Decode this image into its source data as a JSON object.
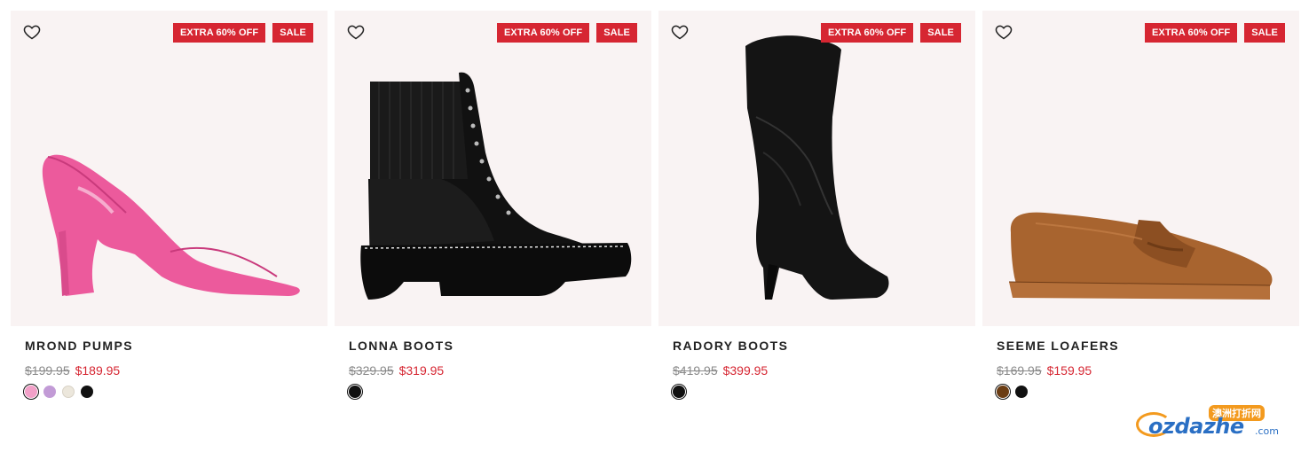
{
  "products": [
    {
      "name": "MROND PUMPS",
      "badge_extra": "EXTRA 60% OFF",
      "badge_sale": "SALE",
      "was_price": "$199.95",
      "now_price": "$189.95",
      "image": "pink-pump",
      "swatches": [
        "#f2a0c8",
        "#c29bd6",
        "#ece7dc",
        "#111111"
      ],
      "selected_swatch": 0
    },
    {
      "name": "LONNA BOOTS",
      "badge_extra": "EXTRA 60% OFF",
      "badge_sale": "SALE",
      "was_price": "$329.95",
      "now_price": "$319.95",
      "image": "black-combat-boot",
      "swatches": [
        "#111111"
      ],
      "selected_swatch": 0
    },
    {
      "name": "RADORY BOOTS",
      "badge_extra": "EXTRA 60% OFF",
      "badge_sale": "SALE",
      "was_price": "$419.95",
      "now_price": "$399.95",
      "image": "black-western-knee-boot",
      "swatches": [
        "#111111"
      ],
      "selected_swatch": 0
    },
    {
      "name": "SEEME LOAFERS",
      "badge_extra": "EXTRA 60% OFF",
      "badge_sale": "SALE",
      "was_price": "$169.95",
      "now_price": "$159.95",
      "image": "tan-penny-loafer",
      "swatches": [
        "#6b3d14",
        "#111111"
      ],
      "selected_swatch": 0
    }
  ],
  "watermark": {
    "cn_text": "澳洲打折网",
    "brand": "ozdazhe",
    "tld": ".com"
  },
  "colors": {
    "sale_red": "#d62632",
    "card_bg": "#f9f3f3",
    "strike_gray": "#8a8a8a"
  }
}
